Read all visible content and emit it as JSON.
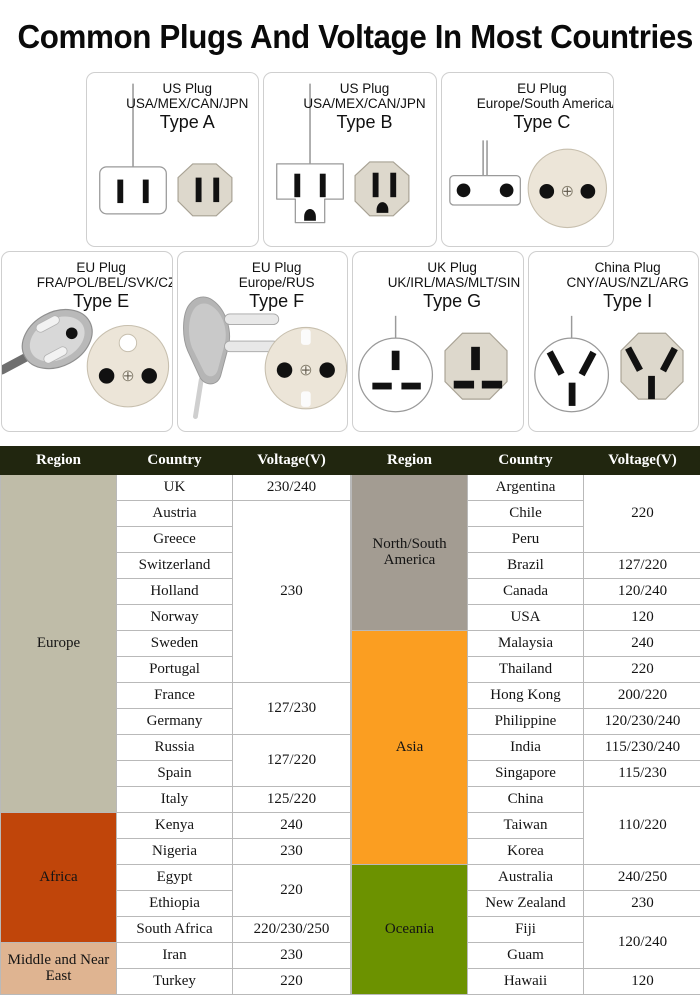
{
  "page": {
    "title": "Common Plugs And Voltage In Most Countries"
  },
  "colors": {
    "header_bg": "#21260f",
    "europe": "#bfbca8",
    "africa": "#c0450a",
    "middle_east": "#dfb491",
    "americas": "#a39c92",
    "asia": "#fb9e21",
    "oceania": "#6c9200",
    "socket_beige": "#ddd8cc",
    "plug_gray": "#b0b0b0",
    "border": "#b9b9b9"
  },
  "plugs": [
    {
      "id": "type-a",
      "name": "US Plug",
      "countries": "USA/MEX/CAN/JPN",
      "type": "Type A"
    },
    {
      "id": "type-b",
      "name": "US Plug",
      "countries": "USA/MEX/CAN/JPN",
      "type": "Type B"
    },
    {
      "id": "type-c",
      "name": "EU Plug",
      "countries": "Europe/South America/Asia",
      "type": "Type C"
    },
    {
      "id": "type-e",
      "name": "EU Plug",
      "countries": "FRA/POL/BEL/SVK/CZE",
      "type": "Type E"
    },
    {
      "id": "type-f",
      "name": "EU Plug",
      "countries": "Europe/RUS",
      "type": "Type F"
    },
    {
      "id": "type-g",
      "name": "UK Plug",
      "countries": "UK/IRL/MAS/MLT/SIN",
      "type": "Type G"
    },
    {
      "id": "type-i",
      "name": "China Plug",
      "countries": "CNY/AUS/NZL/ARG",
      "type": "Type I"
    }
  ],
  "table": {
    "headers": {
      "region": "Region",
      "country": "Country",
      "voltage": "Voltage(V)"
    },
    "left": {
      "regions": [
        {
          "name": "Europe",
          "color": "#bfbca8",
          "rows": 12,
          "countries": [
            "UK",
            "Austria",
            "Greece",
            "Switzerland",
            "Holland",
            "Norway",
            "Sweden",
            "Portugal",
            "France",
            "Germany",
            "Russia",
            "Spain",
            "Italy"
          ],
          "voltages": [
            {
              "value": "230/240",
              "span": 1
            },
            {
              "value": "230",
              "span": 7
            },
            {
              "value": "127/230",
              "span": 2
            },
            {
              "value": "127/220",
              "span": 2
            },
            {
              "value": "125/220",
              "span": 1
            }
          ]
        },
        {
          "name": "Africa",
          "color": "#c0450a",
          "rows": 5,
          "countries": [
            "Kenya",
            "Nigeria",
            "Egypt",
            "Ethiopia",
            "South Africa"
          ],
          "voltages": [
            {
              "value": "240",
              "span": 1
            },
            {
              "value": "230",
              "span": 1
            },
            {
              "value": "220",
              "span": 2
            },
            {
              "value": "220/230/250",
              "span": 1
            }
          ]
        },
        {
          "name": "Middle and Near East",
          "color": "#dfb491",
          "rows": 2,
          "countries": [
            "Iran",
            "Turkey"
          ],
          "voltages": [
            {
              "value": "230",
              "span": 1
            },
            {
              "value": "220",
              "span": 1
            }
          ]
        }
      ]
    },
    "right": {
      "regions": [
        {
          "name": "North/South America",
          "color": "#a39c92",
          "rows": 6,
          "countries": [
            "Argentina",
            "Chile",
            "Peru",
            "Brazil",
            "Canada",
            "USA"
          ],
          "voltages": [
            {
              "value": "220",
              "span": 3
            },
            {
              "value": "127/220",
              "span": 1
            },
            {
              "value": "120/240",
              "span": 1
            },
            {
              "value": "120",
              "span": 1
            }
          ]
        },
        {
          "name": "Asia",
          "color": "#fb9e21",
          "rows": 9,
          "countries": [
            "Malaysia",
            "Thailand",
            "Hong Kong",
            "Philippine",
            "India",
            "Singapore",
            "China",
            "Taiwan",
            "Korea"
          ],
          "voltages": [
            {
              "value": "240",
              "span": 1
            },
            {
              "value": "220",
              "span": 1
            },
            {
              "value": "200/220",
              "span": 1
            },
            {
              "value": "120/230/240",
              "span": 1
            },
            {
              "value": "115/230/240",
              "span": 1
            },
            {
              "value": "115/230",
              "span": 1
            },
            {
              "value": "110/220",
              "span": 3
            }
          ]
        },
        {
          "name": "Oceania",
          "color": "#6c9200",
          "rows": 5,
          "countries": [
            "Australia",
            "New Zealand",
            "Fiji",
            "Guam",
            "Hawaii"
          ],
          "voltages": [
            {
              "value": "240/250",
              "span": 1
            },
            {
              "value": "230",
              "span": 1
            },
            {
              "value": "120/240",
              "span": 2
            },
            {
              "value": "120",
              "span": 1
            }
          ]
        }
      ]
    }
  }
}
